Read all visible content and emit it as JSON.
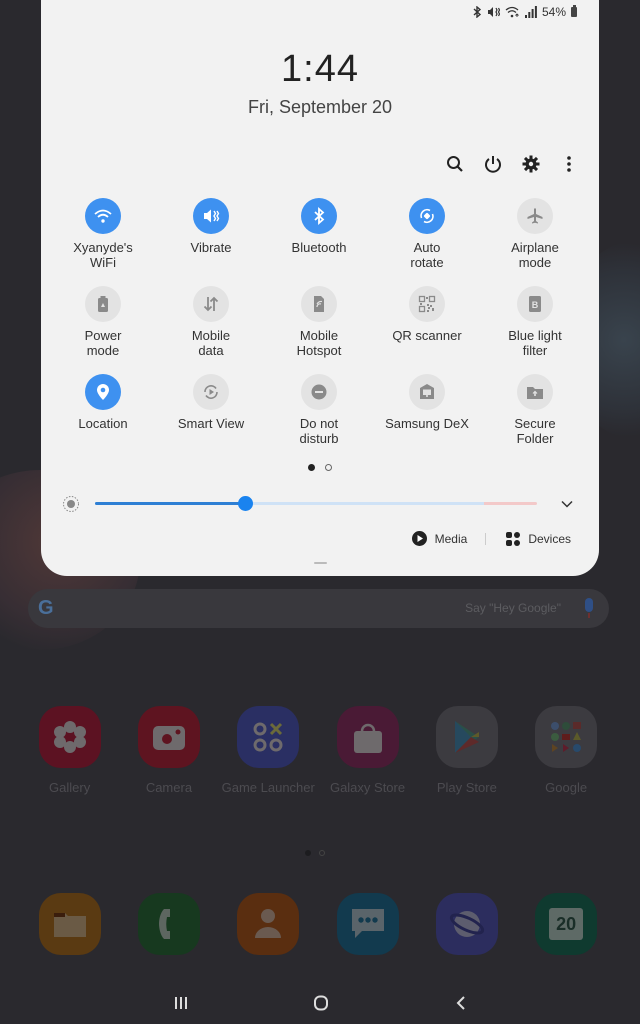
{
  "status_bar": {
    "icons": [
      "bluetooth-icon",
      "vibrate-icon",
      "wifi-icon",
      "signal-icon"
    ],
    "battery": "54%"
  },
  "panel": {
    "time": "1:44",
    "date": "Fri, September 20",
    "toolbar": [
      "search-icon",
      "power-icon",
      "gear-icon",
      "more-icon"
    ],
    "tiles": [
      {
        "label": "Xyanyde's\nWiFi",
        "icon": "wifi-icon",
        "on": true
      },
      {
        "label": "Vibrate",
        "icon": "vibrate-icon",
        "on": true
      },
      {
        "label": "Bluetooth",
        "icon": "bluetooth-icon",
        "on": true
      },
      {
        "label": "Auto\nrotate",
        "icon": "rotate-icon",
        "on": true
      },
      {
        "label": "Airplane\nmode",
        "icon": "airplane-icon",
        "on": false
      },
      {
        "label": "Power\nmode",
        "icon": "battery-recycle-icon",
        "on": false
      },
      {
        "label": "Mobile\ndata",
        "icon": "data-arrows-icon",
        "on": false
      },
      {
        "label": "Mobile\nHotspot",
        "icon": "hotspot-icon",
        "on": false
      },
      {
        "label": "QR scanner",
        "icon": "qr-icon",
        "on": false
      },
      {
        "label": "Blue light\nfilter",
        "icon": "blue-light-icon",
        "on": false
      },
      {
        "label": "Location",
        "icon": "location-pin-icon",
        "on": true
      },
      {
        "label": "Smart View",
        "icon": "smart-view-icon",
        "on": false
      },
      {
        "label": "Do not\ndisturb",
        "icon": "do-not-disturb-icon",
        "on": false
      },
      {
        "label": "Samsung DeX",
        "icon": "dex-icon",
        "on": false
      },
      {
        "label": "Secure\nFolder",
        "icon": "secure-folder-icon",
        "on": false
      }
    ],
    "page_indicator": {
      "current": 1,
      "total": 2
    },
    "brightness": {
      "value_percent": 34
    },
    "media_label": "Media",
    "devices_label": "Devices"
  },
  "home": {
    "search_hint": "Say \"Hey Google\"",
    "google_letter": "G",
    "apps": [
      {
        "name": "Gallery",
        "color": "#5c1222"
      },
      {
        "name": "Camera",
        "color": "#5e1420"
      },
      {
        "name": "Game Launcher",
        "color": "#2a2f63"
      },
      {
        "name": "Galaxy Store",
        "color": "#4a1a35"
      },
      {
        "name": "Play Store",
        "color": "#3c3b40"
      },
      {
        "name": "Google",
        "color": "#3c3b40"
      }
    ],
    "dock": [
      {
        "name": "My Files",
        "color": "#5a3a12"
      },
      {
        "name": "Phone",
        "color": "#17391f"
      },
      {
        "name": "Contacts",
        "color": "#5a2e10"
      },
      {
        "name": "Messages",
        "color": "#123a4e"
      },
      {
        "name": "Internet",
        "color": "#2c2d5e"
      },
      {
        "name": "Calendar",
        "color": "#0f3a2f",
        "badge": "20"
      }
    ],
    "page_indicator": {
      "current": 1,
      "total": 2
    }
  },
  "nav": [
    "recents-icon",
    "home-icon",
    "back-icon"
  ]
}
